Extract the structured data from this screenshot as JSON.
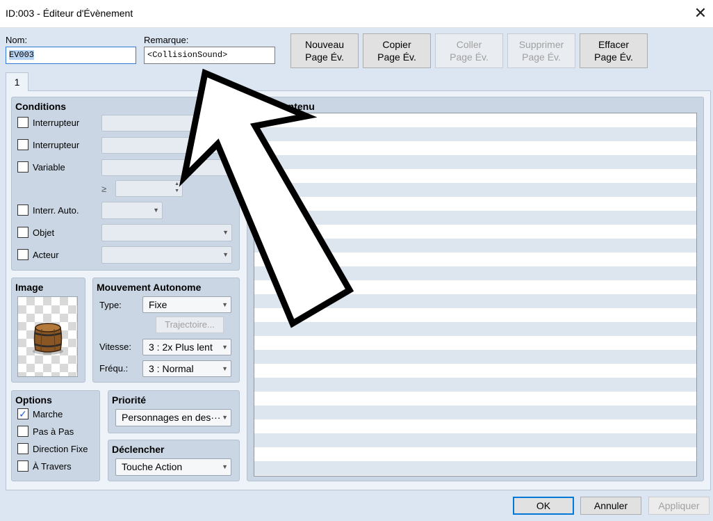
{
  "window": {
    "title": "ID:003 - Éditeur d'Évènement",
    "close_icon": "✕"
  },
  "header": {
    "name_label": "Nom:",
    "name_value": "EV003",
    "note_label": "Remarque:",
    "note_value": "<CollisionSound>",
    "buttons": [
      {
        "line1": "Nouveau",
        "line2": "Page Év.",
        "enabled": true
      },
      {
        "line1": "Copier",
        "line2": "Page Év.",
        "enabled": true
      },
      {
        "line1": "Coller",
        "line2": "Page Év.",
        "enabled": false
      },
      {
        "line1": "Supprimer",
        "line2": "Page Év.",
        "enabled": false
      },
      {
        "line1": "Effacer",
        "line2": "Page Év.",
        "enabled": true
      }
    ]
  },
  "tabs": [
    {
      "label": "1"
    }
  ],
  "conditions": {
    "title": "Conditions",
    "rows": [
      {
        "label": "Interrupteur",
        "checked": false
      },
      {
        "label": "Interrupteur",
        "checked": false
      },
      {
        "label": "Variable",
        "checked": false
      },
      {
        "label": "Interr. Auto.",
        "checked": false
      },
      {
        "label": "Objet",
        "checked": false
      },
      {
        "label": "Acteur",
        "checked": false
      }
    ],
    "ge_symbol": "≥"
  },
  "image": {
    "title": "Image",
    "sprite": "barrel"
  },
  "movement": {
    "title": "Mouvement Autonome",
    "type_label": "Type:",
    "type_value": "Fixe",
    "route_button": "Trajectoire...",
    "speed_label": "Vitesse:",
    "speed_value": "3 : 2x Plus lent",
    "freq_label": "Fréqu.:",
    "freq_value": "3 : Normal"
  },
  "options": {
    "title": "Options",
    "items": [
      {
        "label": "Marche",
        "checked": true
      },
      {
        "label": "Pas à Pas",
        "checked": false
      },
      {
        "label": "Direction Fixe",
        "checked": false
      },
      {
        "label": "À Travers",
        "checked": false
      }
    ]
  },
  "priority": {
    "title": "Priorité",
    "value": "Personnages en des···"
  },
  "trigger": {
    "title": "Déclencher",
    "value": "Touche Action"
  },
  "contents": {
    "title": "Contenu"
  },
  "footer": {
    "ok": "OK",
    "cancel": "Annuler",
    "apply": "Appliquer"
  },
  "overlay": {
    "annotation": "arrow-pointer"
  },
  "colors": {
    "accent": "#0078d7",
    "panel": "#cad6e4",
    "background": "#dce6f2"
  }
}
